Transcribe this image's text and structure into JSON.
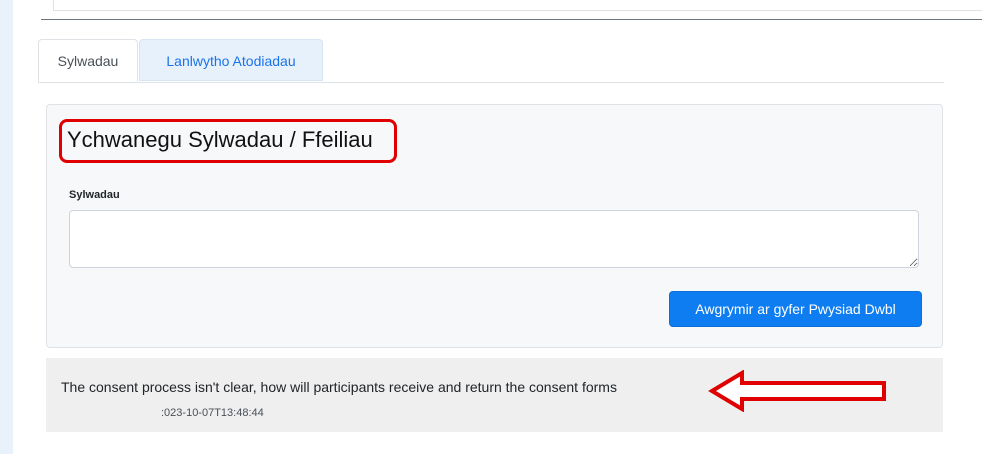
{
  "tabs": [
    {
      "label": "Sylwadau",
      "active": true
    },
    {
      "label": "Lanlwytho Atodiadau",
      "active": false
    }
  ],
  "form": {
    "title": "Ychwanegu Sylwadau / Ffeiliau",
    "field_label": "Sylwadau",
    "field_value": "",
    "submit_label": "Awgrymir ar gyfer Pwysiad Dwbl"
  },
  "comments": [
    {
      "text": "The consent process isn't clear, how will participants receive and return the consent forms",
      "timestamp": ":023-10-07T13:48:44"
    }
  ],
  "colors": {
    "accent": "#0d7df1",
    "annotation": "#e00000"
  },
  "icons": {
    "annotation_arrow": "left-arrow-icon"
  }
}
